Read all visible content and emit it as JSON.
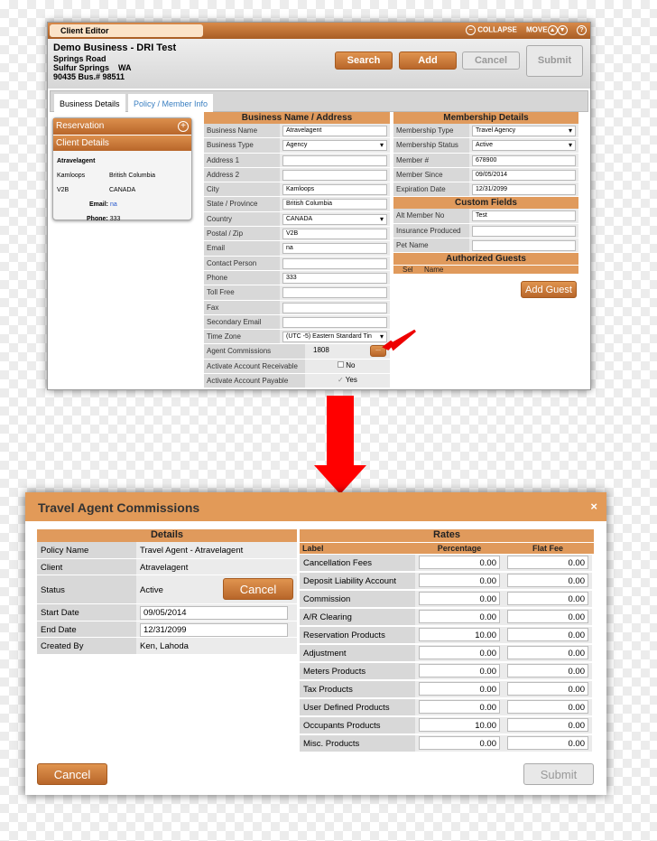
{
  "editor": {
    "title": "Client Editor",
    "collapse": "COLLAPSE",
    "move": "MOVE",
    "client_name": "Demo Business - DRI Test",
    "addr1": "Springs Road",
    "addr2": "Sulfur Springs    WA",
    "addr3": "90435  Bus.# 98511",
    "buttons": {
      "search": "Search",
      "add": "Add",
      "cancel": "Cancel",
      "submit": "Submit"
    },
    "tabs": [
      "Business Details",
      "Policy / Member Info"
    ],
    "card": {
      "reservation": "Reservation",
      "client_details": "Client Details",
      "name": "Atravelagent",
      "city": "Kamloops",
      "province": "British Columbia",
      "postal": "V2B",
      "country": "CANADA",
      "email_label": "Email:",
      "email": "na",
      "phone_label": "Phone:",
      "phone": "333"
    },
    "business_title": "Business Name / Address",
    "business_rows": [
      {
        "label": "Business Name",
        "value": "Atravelagent"
      },
      {
        "label": "Business Type",
        "value": "Agency",
        "select": true
      },
      {
        "label": "Address 1",
        "value": ""
      },
      {
        "label": "Address 2",
        "value": ""
      },
      {
        "label": "City",
        "value": "Kamloops"
      },
      {
        "label": "State / Province",
        "value": "British Columbia"
      },
      {
        "label": "Country",
        "value": "CANADA",
        "select": true
      },
      {
        "label": "Postal / Zip",
        "value": "V2B"
      },
      {
        "label": "Email",
        "value": "na"
      },
      {
        "label": "Contact Person",
        "value": ""
      },
      {
        "label": "Phone",
        "value": "333"
      },
      {
        "label": "Toll Free",
        "value": ""
      },
      {
        "label": "Fax",
        "value": ""
      },
      {
        "label": "Secondary Email",
        "value": ""
      },
      {
        "label": "Time Zone",
        "value": "(UTC -5) Eastern Standard Tin",
        "select": true
      }
    ],
    "agent_commissions": {
      "label": "Agent Commissions",
      "value": "1808",
      "button": "..."
    },
    "receivable": {
      "label": "Activate Account Receivable",
      "value": "No",
      "checked": false
    },
    "payable": {
      "label": "Activate Account Payable",
      "value": "Yes",
      "checked": true
    },
    "membership_title": "Membership Details",
    "membership_rows": [
      {
        "label": "Membership Type",
        "value": "Travel Agency",
        "select": true
      },
      {
        "label": "Membership Status",
        "value": "Active",
        "select": true
      },
      {
        "label": "Member #",
        "value": "678900"
      },
      {
        "label": "Member Since",
        "value": "09/05/2014"
      },
      {
        "label": "Expiration Date",
        "value": "12/31/2099"
      }
    ],
    "custom_title": "Custom Fields",
    "custom_rows": [
      {
        "label": "Alt Member No",
        "value": "Test"
      },
      {
        "label": "Insurance Produced",
        "value": ""
      },
      {
        "label": "Pet Name",
        "value": ""
      }
    ],
    "guests_title": "Authorized Guests",
    "guests_cols": [
      "Sel",
      "Name"
    ],
    "add_guest": "Add Guest"
  },
  "dialog": {
    "title": "Travel Agent Commissions",
    "close": "×",
    "details_title": "Details",
    "details": [
      {
        "label": "Policy Name",
        "value": "Travel Agent - Atravelagent"
      },
      {
        "label": "Client",
        "value": "Atravelagent"
      },
      {
        "label": "Status",
        "value": "Active"
      },
      {
        "label": "Start Date",
        "value": "09/05/2014",
        "input": true
      },
      {
        "label": "End Date",
        "value": "12/31/2099",
        "input": true
      },
      {
        "label": "Created By",
        "value": "Ken, Lahoda"
      }
    ],
    "status_cancel": "Cancel",
    "rates_title": "Rates",
    "rates_cols": [
      "Label",
      "Percentage",
      "Flat Fee"
    ],
    "rates": [
      {
        "label": "Cancellation Fees",
        "pct": "0.00",
        "flat": "0.00"
      },
      {
        "label": "Deposit Liability Account",
        "pct": "0.00",
        "flat": "0.00"
      },
      {
        "label": "Commission",
        "pct": "0.00",
        "flat": "0.00"
      },
      {
        "label": "A/R Clearing",
        "pct": "0.00",
        "flat": "0.00"
      },
      {
        "label": "Reservation Products",
        "pct": "10.00",
        "flat": "0.00"
      },
      {
        "label": "Adjustment",
        "pct": "0.00",
        "flat": "0.00"
      },
      {
        "label": "Meters Products",
        "pct": "0.00",
        "flat": "0.00"
      },
      {
        "label": "Tax Products",
        "pct": "0.00",
        "flat": "0.00"
      },
      {
        "label": "User Defined Products",
        "pct": "0.00",
        "flat": "0.00"
      },
      {
        "label": "Occupants Products",
        "pct": "10.00",
        "flat": "0.00"
      },
      {
        "label": "Misc. Products",
        "pct": "0.00",
        "flat": "0.00"
      }
    ],
    "cancel": "Cancel",
    "submit": "Submit"
  },
  "colors": {
    "accent": "#e09a5c",
    "arrow": "#ff0000"
  }
}
